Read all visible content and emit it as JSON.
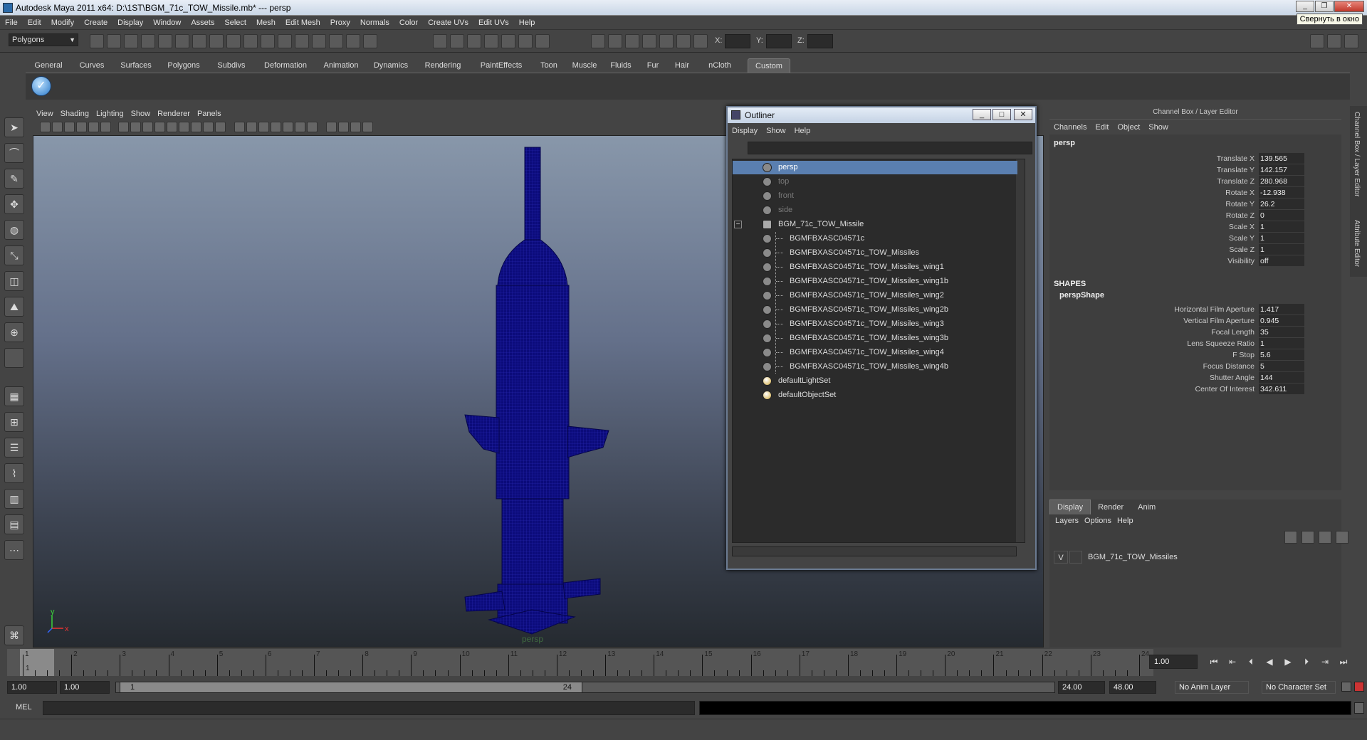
{
  "window": {
    "title": "Autodesk Maya 2011 x64: D:\\1ST\\BGM_71c_TOW_Missile.mb*   ---   persp",
    "tooltip": "Свернуть в окно"
  },
  "menubar": [
    "File",
    "Edit",
    "Modify",
    "Create",
    "Display",
    "Window",
    "Assets",
    "Select",
    "Mesh",
    "Edit Mesh",
    "Proxy",
    "Normals",
    "Color",
    "Create UVs",
    "Edit UVs",
    "Help"
  ],
  "status_line": {
    "mode": "Polygons",
    "x_label": "X:",
    "y_label": "Y:",
    "z_label": "Z:"
  },
  "shelf_tabs": [
    "General",
    "Curves",
    "Surfaces",
    "Polygons",
    "Subdivs",
    "Deformation",
    "Animation",
    "Dynamics",
    "Rendering",
    "PaintEffects",
    "Toon",
    "Muscle",
    "Fluids",
    "Fur",
    "Hair",
    "nCloth",
    "Custom"
  ],
  "shelf_active": "Custom",
  "panel_menu": [
    "View",
    "Shading",
    "Lighting",
    "Show",
    "Renderer",
    "Panels"
  ],
  "viewport": {
    "camera_label": "persp",
    "axis_y": "y",
    "axis_x": "x",
    "wire_color": "#0a0a8a"
  },
  "outliner": {
    "title": "Outliner",
    "menu": [
      "Display",
      "Show",
      "Help"
    ],
    "items": [
      {
        "label": "persp",
        "indent": 0,
        "selected": true,
        "dim": false,
        "icon": "camera-icon"
      },
      {
        "label": "top",
        "indent": 0,
        "selected": false,
        "dim": true,
        "icon": "camera-icon"
      },
      {
        "label": "front",
        "indent": 0,
        "selected": false,
        "dim": true,
        "icon": "camera-icon"
      },
      {
        "label": "side",
        "indent": 0,
        "selected": false,
        "dim": true,
        "icon": "camera-icon"
      },
      {
        "label": "BGM_71c_TOW_Missile",
        "indent": 0,
        "selected": false,
        "dim": false,
        "icon": "transform-icon",
        "expand": "−"
      },
      {
        "label": "BGMFBXASC04571c",
        "indent": 1,
        "selected": false,
        "dim": false,
        "icon": "mesh-icon"
      },
      {
        "label": "BGMFBXASC04571c_TOW_Missiles",
        "indent": 1,
        "selected": false,
        "dim": false,
        "icon": "mesh-icon"
      },
      {
        "label": "BGMFBXASC04571c_TOW_Missiles_wing1",
        "indent": 1,
        "selected": false,
        "dim": false,
        "icon": "mesh-icon"
      },
      {
        "label": "BGMFBXASC04571c_TOW_Missiles_wing1b",
        "indent": 1,
        "selected": false,
        "dim": false,
        "icon": "mesh-icon"
      },
      {
        "label": "BGMFBXASC04571c_TOW_Missiles_wing2",
        "indent": 1,
        "selected": false,
        "dim": false,
        "icon": "mesh-icon"
      },
      {
        "label": "BGMFBXASC04571c_TOW_Missiles_wing2b",
        "indent": 1,
        "selected": false,
        "dim": false,
        "icon": "mesh-icon"
      },
      {
        "label": "BGMFBXASC04571c_TOW_Missiles_wing3",
        "indent": 1,
        "selected": false,
        "dim": false,
        "icon": "mesh-icon"
      },
      {
        "label": "BGMFBXASC04571c_TOW_Missiles_wing3b",
        "indent": 1,
        "selected": false,
        "dim": false,
        "icon": "mesh-icon"
      },
      {
        "label": "BGMFBXASC04571c_TOW_Missiles_wing4",
        "indent": 1,
        "selected": false,
        "dim": false,
        "icon": "mesh-icon"
      },
      {
        "label": "BGMFBXASC04571c_TOW_Missiles_wing4b",
        "indent": 1,
        "selected": false,
        "dim": false,
        "icon": "mesh-icon"
      },
      {
        "label": "defaultLightSet",
        "indent": 0,
        "selected": false,
        "dim": false,
        "icon": "set-icon"
      },
      {
        "label": "defaultObjectSet",
        "indent": 0,
        "selected": false,
        "dim": false,
        "icon": "set-icon"
      }
    ]
  },
  "channel_box": {
    "header": "Channel Box / Layer Editor",
    "menu": [
      "Channels",
      "Edit",
      "Object",
      "Show"
    ],
    "node": "persp",
    "channels": [
      {
        "label": "Translate X",
        "value": "139.565"
      },
      {
        "label": "Translate Y",
        "value": "142.157"
      },
      {
        "label": "Translate Z",
        "value": "280.968"
      },
      {
        "label": "Rotate X",
        "value": "-12.938"
      },
      {
        "label": "Rotate Y",
        "value": "26.2"
      },
      {
        "label": "Rotate Z",
        "value": "0"
      },
      {
        "label": "Scale X",
        "value": "1"
      },
      {
        "label": "Scale Y",
        "value": "1"
      },
      {
        "label": "Scale Z",
        "value": "1"
      },
      {
        "label": "Visibility",
        "value": "off"
      }
    ],
    "shapes_label": "SHAPES",
    "shape_node": "perspShape",
    "shape_channels": [
      {
        "label": "Horizontal Film Aperture",
        "value": "1.417"
      },
      {
        "label": "Vertical Film Aperture",
        "value": "0.945"
      },
      {
        "label": "Focal Length",
        "value": "35"
      },
      {
        "label": "Lens Squeeze Ratio",
        "value": "1"
      },
      {
        "label": "F Stop",
        "value": "5.6"
      },
      {
        "label": "Focus Distance",
        "value": "5"
      },
      {
        "label": "Shutter Angle",
        "value": "144"
      },
      {
        "label": "Center Of Interest",
        "value": "342.611"
      }
    ],
    "side_tabs": [
      "Channel Box / Layer Editor",
      "Attribute Editor"
    ]
  },
  "layer_editor": {
    "tabs": [
      "Display",
      "Render",
      "Anim"
    ],
    "active_tab": "Display",
    "menu": [
      "Layers",
      "Options",
      "Help"
    ],
    "layers": [
      {
        "visible": "V",
        "name": "BGM_71c_TOW_Missiles"
      }
    ]
  },
  "timeline": {
    "frames": [
      "1",
      "2",
      "3",
      "4",
      "5",
      "6",
      "7",
      "8",
      "9",
      "10",
      "11",
      "12",
      "13",
      "14",
      "15",
      "16",
      "17",
      "18",
      "19",
      "20",
      "21",
      "22",
      "23",
      "24"
    ],
    "current_frame": "1.00",
    "current_marker": "1"
  },
  "range": {
    "start_time": "1.00",
    "start_range": "1.00",
    "slider_start": "1",
    "slider_end": "24",
    "end_range": "24.00",
    "end_time": "48.00",
    "anim_layer": "No Anim Layer",
    "character_set": "No Character Set"
  },
  "command_line": {
    "label": "MEL"
  }
}
